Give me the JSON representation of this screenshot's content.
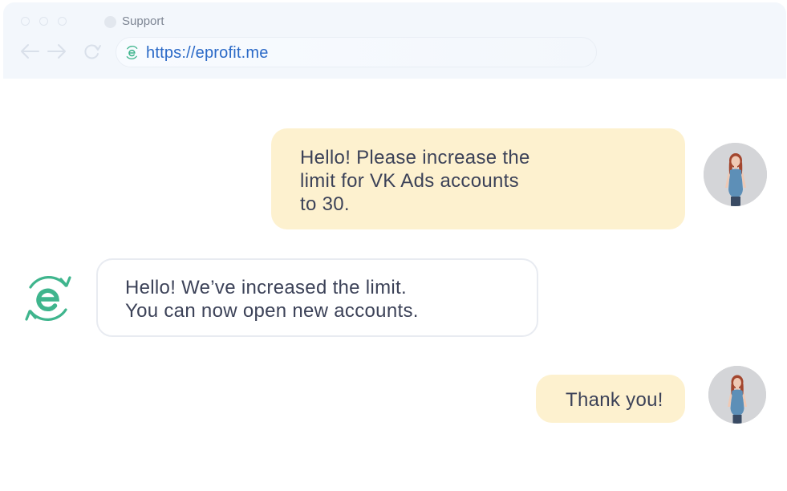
{
  "browser": {
    "tab_label": "Support",
    "url": "https://eprofit.me"
  },
  "chat": {
    "messages": [
      {
        "sender": "user",
        "text": "Hello! Please increase the\nlimit for VK Ads accounts\nto 30."
      },
      {
        "sender": "support",
        "text": "Hello! We’ve increased the limit.\nYou can now open new accounts."
      },
      {
        "sender": "user",
        "text": "Thank you!"
      }
    ]
  },
  "colors": {
    "brand": "#3fb58d",
    "user_bubble": "#fdf1cf",
    "link": "#2a69c7"
  }
}
